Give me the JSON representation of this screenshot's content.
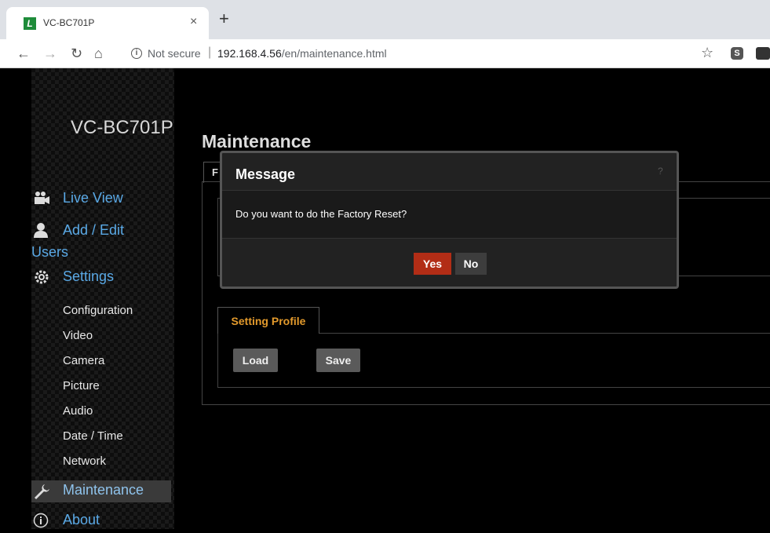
{
  "browser": {
    "tab_title": "VC-BC701P",
    "tab_favicon": "L",
    "not_secure": "Not secure",
    "url_host": "192.168.4.56",
    "url_path": "/en/maintenance.html"
  },
  "sidebar": {
    "model": "VC-BC701P",
    "main_items": [
      {
        "label": "Live View",
        "icon": "video-camera-icon"
      },
      {
        "label": "Add / Edit",
        "label2": "Users",
        "icon": "user-icon"
      },
      {
        "label": "Settings",
        "icon": "gear-icon"
      }
    ],
    "sub_items": [
      "Configuration",
      "Video",
      "Camera",
      "Picture",
      "Audio",
      "Date / Time",
      "Network"
    ],
    "maintenance": "Maintenance",
    "about": "About"
  },
  "main": {
    "title": "Maintenance",
    "factory_tab_fragment": "F",
    "setting_profile_tab": "Setting Profile",
    "load_button": "Load",
    "save_button": "Save"
  },
  "modal": {
    "title": "Message",
    "help": "?",
    "message": "Do you want to do the Factory Reset?",
    "yes": "Yes",
    "no": "No"
  },
  "colors": {
    "link_blue": "#5aa9e6",
    "tab_orange": "#e39a2c",
    "yes_red": "#b22d16"
  }
}
